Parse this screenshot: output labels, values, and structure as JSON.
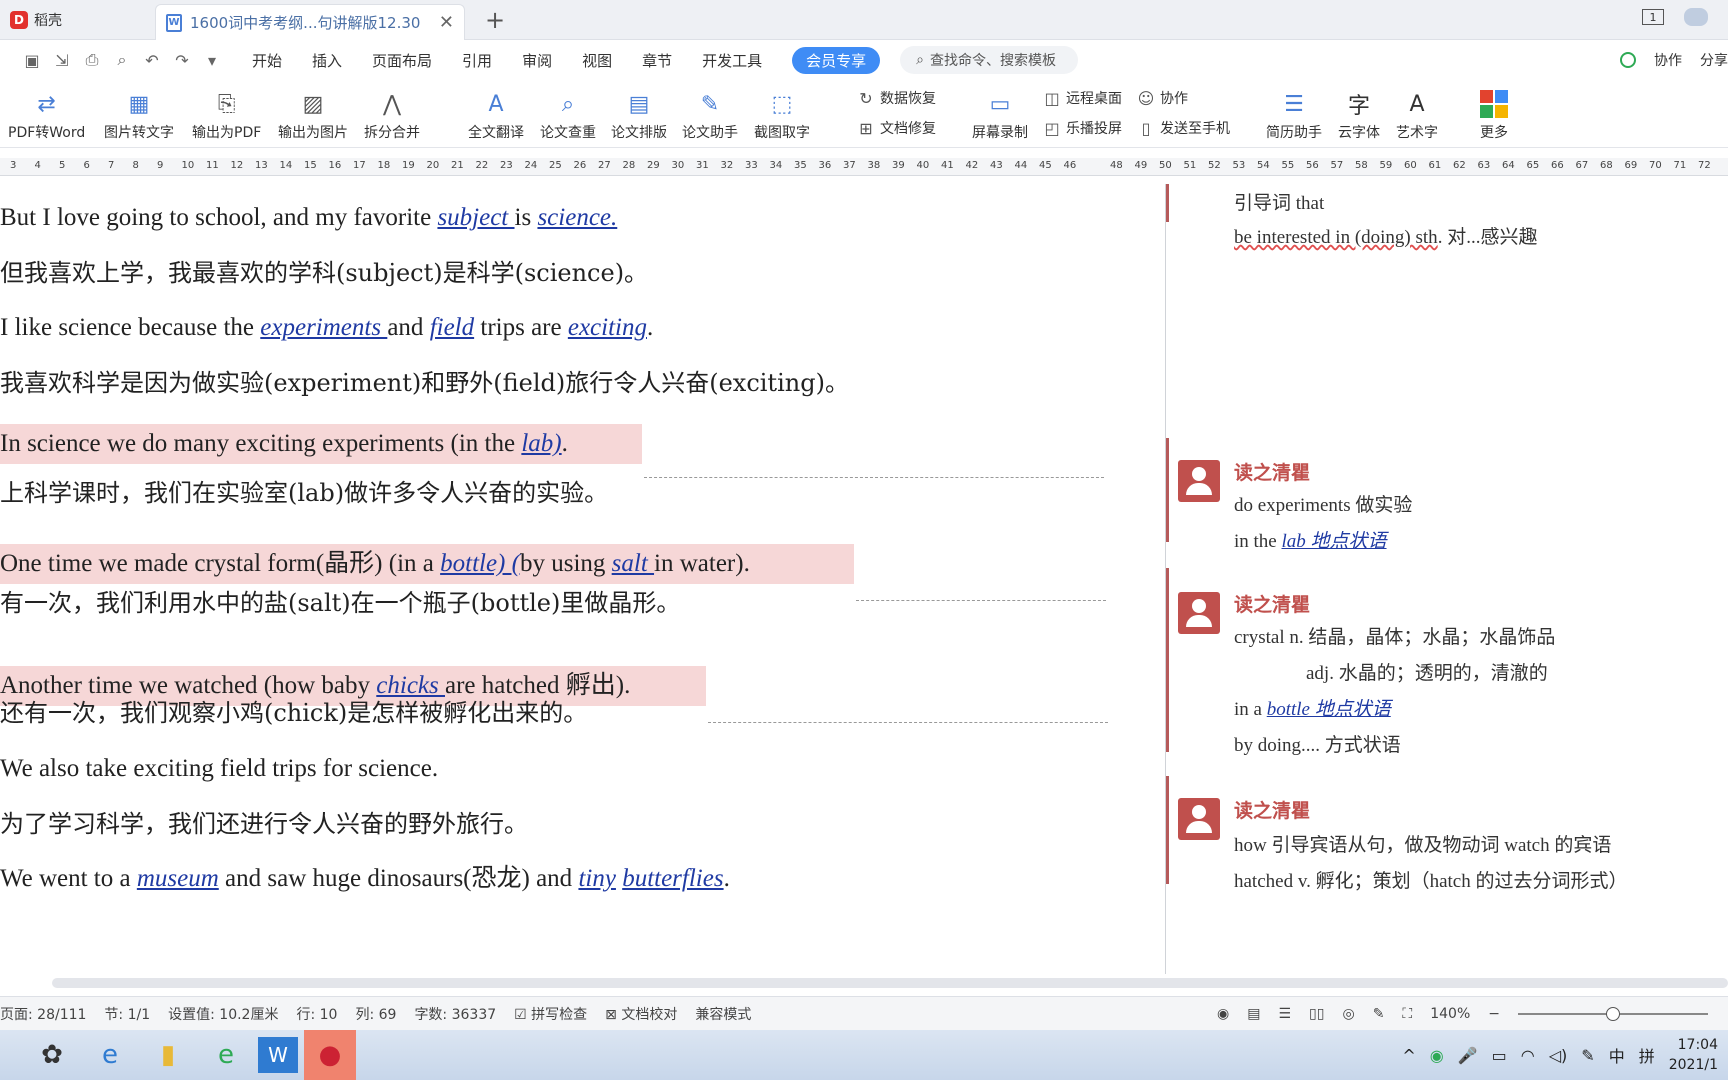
{
  "titlebar": {
    "home_tab": "稻壳",
    "doc_tab": "1600词中考考纲...句讲解版12.30",
    "window_badge": "1"
  },
  "menubar": {
    "items": [
      "开始",
      "插入",
      "页面布局",
      "引用",
      "审阅",
      "视图",
      "章节",
      "开发工具"
    ],
    "vip": "会员专享",
    "search_placeholder": "查找命令、搜索模板",
    "right": [
      "协作",
      "分享"
    ]
  },
  "toolbar": {
    "big": [
      "PDF转Word",
      "图片转文字",
      "输出为PDF",
      "输出为图片",
      "拆分合并",
      "全文翻译",
      "论文查重",
      "论文排版",
      "论文助手",
      "截图取字",
      "屏幕录制",
      "简历助手",
      "云字体",
      "艺术字",
      "更多"
    ],
    "small": [
      "数据恢复",
      "文档修复",
      "远程桌面",
      "乐播投屏",
      "协作",
      "发送至手机"
    ]
  },
  "ruler": [
    "3",
    "4",
    "5",
    "6",
    "7",
    "8",
    "9",
    "10",
    "11",
    "12",
    "13",
    "14",
    "15",
    "16",
    "17",
    "18",
    "19",
    "20",
    "21",
    "22",
    "23",
    "24",
    "25",
    "26",
    "27",
    "28",
    "29",
    "30",
    "31",
    "32",
    "33",
    "34",
    "35",
    "36",
    "37",
    "38",
    "39",
    "40",
    "41",
    "42",
    "43",
    "44",
    "45",
    "46",
    "48",
    "49",
    "50",
    "51",
    "52",
    "53",
    "54",
    "55",
    "56",
    "57",
    "58",
    "59",
    "60",
    "61",
    "62",
    "63",
    "64",
    "65",
    "66",
    "67",
    "68",
    "69",
    "70",
    "71",
    "72"
  ],
  "document": {
    "l1": {
      "a": "But I love going to school, and my favorite ",
      "b": "subject ",
      "c": "is ",
      "d": "science. "
    },
    "l2": "但我喜欢上学，我最喜欢的学科(subject)是科学(science)。",
    "l3": {
      "a": "I like science because the ",
      "b": "experiments ",
      "c": "and ",
      "d": "field",
      "e": " trips are ",
      "f": "exciting",
      "g": "."
    },
    "l4": "我喜欢科学是因为做实验(experiment)和野外(field)旅行令人兴奋(exciting)。",
    "l5": {
      "a": "In science we do many exciting experiments (in the ",
      "b": "lab)",
      "c": "."
    },
    "l6": "上科学课时，我们在实验室(lab)做许多令人兴奋的实验。",
    "l7": {
      "a": "One time we made crystal form(晶形) (in a ",
      "b": "bottle) (",
      "c": "by using ",
      "d": "salt ",
      "e": "in water)."
    },
    "l8": "有一次，我们利用水中的盐(salt)在一个瓶子(bottle)里做晶形。",
    "l9": {
      "a": "Another time we watched (how baby ",
      "b": "chicks ",
      "c": "are hatched 孵出)."
    },
    "l10": "还有一次，我们观察小鸡(chick)是怎样被孵化出来的。",
    "l11": "We also take exciting field trips for science.",
    "l12": "为了学习科学，我们还进行令人兴奋的野外旅行。",
    "l13": {
      "a": "We went to a ",
      "b": "museum",
      "c": " and saw huge dinosaurs(恐龙) and ",
      "d": "tiny",
      "e": " ",
      "f": "butterflies",
      "g": "."
    }
  },
  "comments": {
    "top": {
      "line1": "引导词 that",
      "line2a": "be interested in (doing) sth",
      "line2b": ".  对...感兴趣"
    },
    "c1": {
      "author": "读之清瞿",
      "line1": "do experiments  做实验",
      "line2a": "in the ",
      "line2b": "lab  地点状语"
    },
    "c2": {
      "author": "读之清瞿",
      "line1": "crystal    n. 结晶，晶体；水晶；水晶饰品",
      "line2": "adj. 水晶的；透明的，清澈的",
      "line3a": "in a ",
      "line3b": "bottle  地点状语",
      "line4": "by doing....  方式状语"
    },
    "c3": {
      "author": "读之清瞿",
      "line1": "how 引导宾语从句，做及物动词 watch 的宾语",
      "line2": "hatched v. 孵化；策划（hatch 的过去分词形式）"
    }
  },
  "status": {
    "page": "页面: 28/111",
    "section": "节: 1/1",
    "setting": "设置值: 10.2厘米",
    "row": "行: 10",
    "col": "列: 69",
    "words": "字数: 36337",
    "spell": "拼写检查",
    "proof": "文档校对",
    "compat": "兼容模式",
    "zoom": "140%"
  },
  "taskbar": {
    "ime": "中",
    "ime2": "拼",
    "time": "17:04",
    "date": "2021/1"
  },
  "colors": {
    "accent": "#3f8cf5",
    "highlight": "#f6d7d7",
    "comment_author": "#c0504d",
    "link": "#1f3aa3"
  }
}
